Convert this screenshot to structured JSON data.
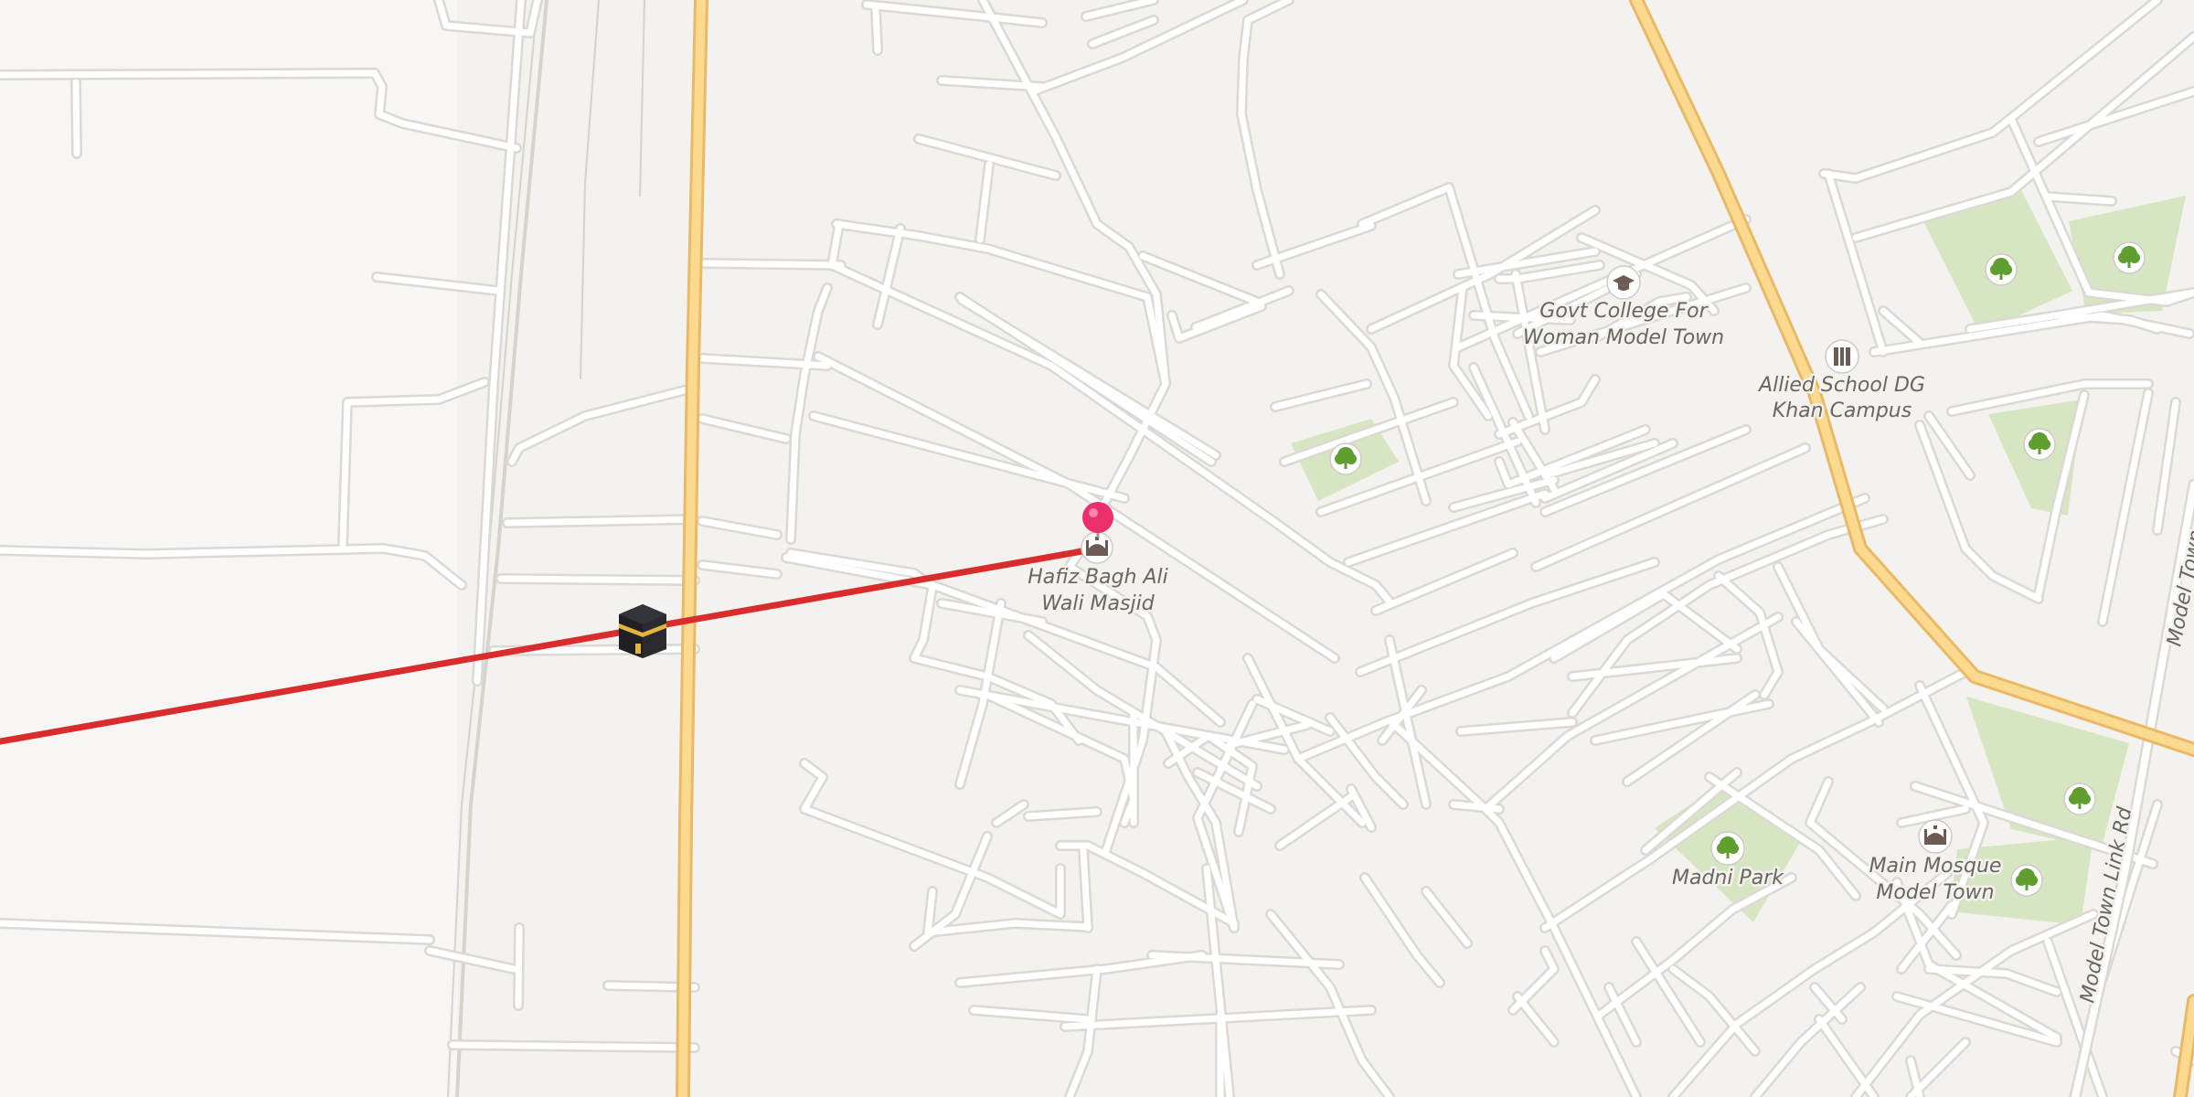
{
  "map": {
    "colors": {
      "background": "#f4f2ef",
      "minor_road": "#ffffff",
      "road_casing": "#dcd8d3",
      "major_road": "#fbd98e",
      "major_road_casing": "#e9b968",
      "park": "#d7e6c2",
      "qibla_line": "#d92d2d",
      "marker": "#ea2f6d",
      "poi_icon": "#6b5b53",
      "tree_icon": "#5f9e2f"
    },
    "selected_place": {
      "name_line1": "Hafiz Bagh Ali",
      "name_line2": "Wali Masjid",
      "icon": "mosque-icon"
    },
    "qibla_marker": {
      "icon": "kaaba-icon"
    },
    "pois": [
      {
        "name_line1": "Govt College For",
        "name_line2": "Woman Model Town",
        "icon": "graduation-cap-icon"
      },
      {
        "name_line1": "Allied School DG",
        "name_line2": "Khan Campus",
        "icon": "school-icon"
      },
      {
        "name_line1": "Madni Park",
        "name_line2": "",
        "icon": "tree-icon"
      },
      {
        "name_line1": "Main Mosque",
        "name_line2": "Model Town",
        "icon": "mosque-icon"
      }
    ],
    "road_labels": {
      "link_road": "Model Town Link Rd",
      "partial_road": "Model Town"
    }
  }
}
